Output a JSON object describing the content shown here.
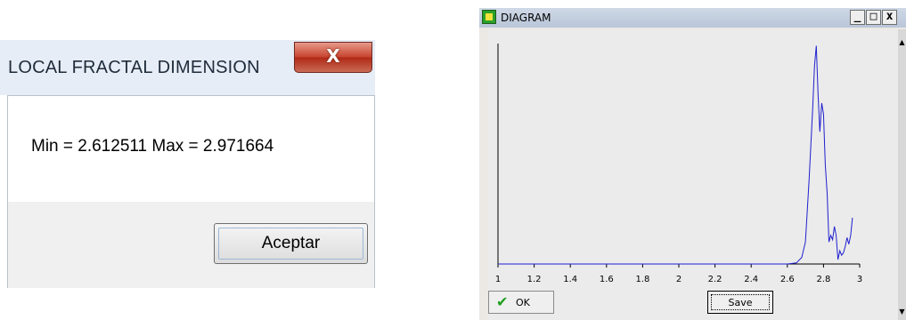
{
  "message_box": {
    "title": "LOCAL FRACTAL DIMENSION",
    "close_label": "X",
    "message": "Min = 2.612511 Max = 2.971664",
    "ok_label": "Aceptar"
  },
  "diagram_window": {
    "title": "DIAGRAM",
    "minimize_label": "_",
    "maximize_label": "□",
    "close_label": "x",
    "scroll_up": "▲",
    "scroll_down": "▼",
    "ok_icon": "check-icon",
    "ok_label": "OK",
    "save_label": "Save",
    "line_color": "#1f1fd0"
  },
  "chart_data": {
    "type": "line",
    "title": "",
    "xlabel": "",
    "ylabel": "",
    "xlim": [
      1.0,
      3.0
    ],
    "ylim": [
      0,
      1.0
    ],
    "x_ticks": [
      "1",
      "1.2",
      "1.4",
      "1.6",
      "1.8",
      "2",
      "2.2",
      "2.4",
      "2.6",
      "2.8",
      "3"
    ],
    "grid": false,
    "series": [
      {
        "x": [
          1.0,
          2.6,
          2.65,
          2.68,
          2.7,
          2.72,
          2.74,
          2.75,
          2.76,
          2.77,
          2.78,
          2.79,
          2.8,
          2.81,
          2.82,
          2.83,
          2.84,
          2.85,
          2.86,
          2.87,
          2.88,
          2.89,
          2.9,
          2.91,
          2.92,
          2.93,
          2.94,
          2.95,
          2.96
        ],
        "y": [
          0.0,
          0.0,
          0.005,
          0.03,
          0.1,
          0.38,
          0.7,
          0.9,
          0.99,
          0.77,
          0.6,
          0.73,
          0.68,
          0.45,
          0.32,
          0.1,
          0.13,
          0.11,
          0.17,
          0.13,
          0.02,
          0.06,
          0.04,
          0.05,
          0.08,
          0.12,
          0.09,
          0.13,
          0.21
        ]
      }
    ]
  }
}
